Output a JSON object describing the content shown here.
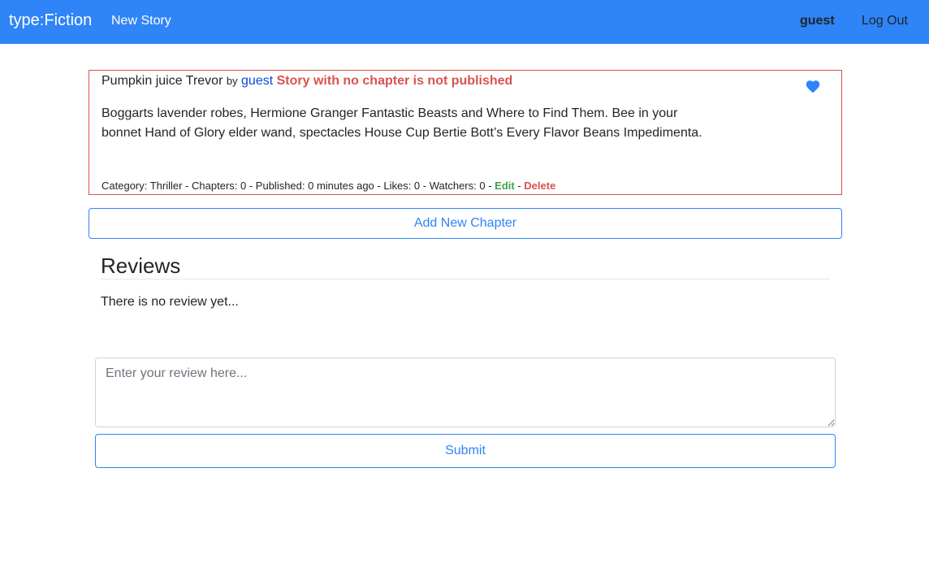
{
  "navbar": {
    "brand": "type:Fiction",
    "new_story": "New Story",
    "username": "guest",
    "logout": "Log Out",
    "background_color": "#2f84f7"
  },
  "story": {
    "title": "Pumpkin juice Trevor",
    "by": "by",
    "author": "guest",
    "warning": "Story with no chapter is not published",
    "summary": "Boggarts lavender robes, Hermione Granger Fantastic Beasts and Where to Find Them. Bee in your bonnet Hand of Glory elder wand, spectacles House Cup Bertie Bott’s Every Flavor Beans Impedimenta.",
    "like_icon": "heart-icon",
    "meta": {
      "category_label": "Category: Thriller",
      "chapters_label": "Chapters: 0",
      "published_label": "Published: 0 minutes ago",
      "likes_label": "Likes: 0",
      "watchers_label": "Watchers: 0",
      "separator": " - ",
      "edit": "Edit",
      "delete": "Delete"
    },
    "border_color": "#d9534f"
  },
  "actions": {
    "add_chapter": "Add New Chapter"
  },
  "reviews": {
    "title": "Reviews",
    "empty_text": "There is no review yet...",
    "input_value": "",
    "input_placeholder": "Enter your review here...",
    "submit": "Submit"
  },
  "colors": {
    "accent": "#2f84f7",
    "danger": "#d9534f",
    "success": "#3fa34d",
    "author_link": "#0d47d8"
  }
}
